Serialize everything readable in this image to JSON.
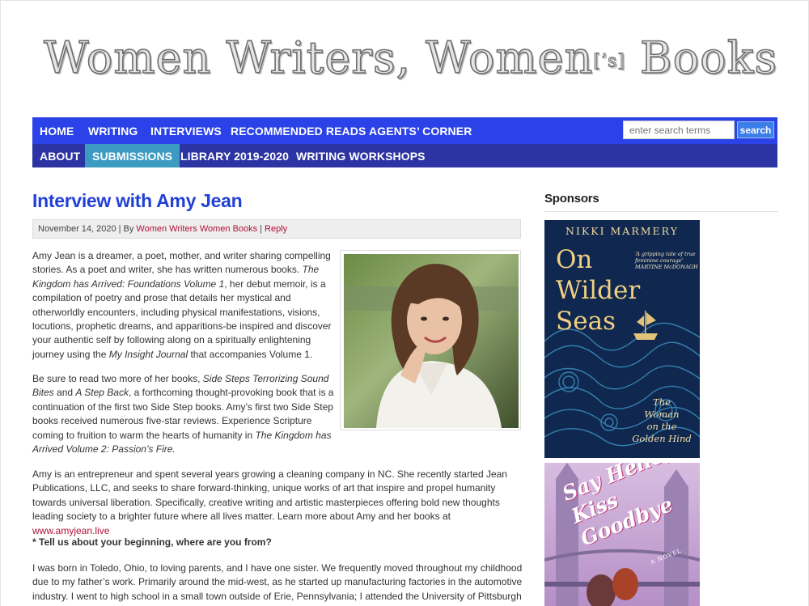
{
  "site": {
    "logo_text_a": "Women Writers, Women",
    "logo_bracket": "[’s]",
    "logo_text_b": " Books"
  },
  "nav": {
    "row1": [
      "HOME",
      "WRITING",
      "INTERVIEWS",
      "RECOMMENDED READS",
      "AGENTS’ CORNER"
    ],
    "row2": [
      "ABOUT",
      "SUBMISSIONS",
      "LIBRARY 2019-2020",
      "WRITING WORKSHOPS"
    ],
    "active": "SUBMISSIONS",
    "search_placeholder": "enter search terms",
    "search_button": "search",
    "colors": {
      "row1": "#2a42e8",
      "row2": "#2c34a4",
      "active": "#3d9bc2"
    }
  },
  "post": {
    "title": "Interview with Amy Jean",
    "meta": {
      "date": "November 14, 2020",
      "by": "By",
      "author_link": "Women Writers Women Books",
      "reply": "Reply"
    },
    "photo_alt_icon": "author-portrait-image",
    "p1": [
      {
        "t": "Amy Jean is a dreamer, a poet, mother, and writer sharing compelling stories. As a poet and writer, she has written numerous books. "
      },
      {
        "t": "The Kingdom has Arrived: Foundations Volume 1",
        "i": true
      },
      {
        "t": ", her debut memoir, is a compilation of poetry and prose that details her mystical and otherworldly encounters, including physical manifestations, visions, locutions, prophetic dreams, and apparitions-be inspired and discover your authentic self by following along on a spiritually enlightening journey using the "
      },
      {
        "t": "My Insight Journal",
        "i": true
      },
      {
        "t": " that accompanies Volume 1."
      }
    ],
    "p2": [
      {
        "t": "Be sure to read two more of her books, "
      },
      {
        "t": "Side Steps Terrorizing Sound Bites",
        "i": true
      },
      {
        "t": " and "
      },
      {
        "t": "A Step Back",
        "i": true
      },
      {
        "t": ", a forthcoming thought-provoking book that is a continuation of the first two Side Step books. Amy’s first two Side Step books received numerous five-star reviews. Experience Scripture coming to fruition to warm the hearts of humanity in "
      },
      {
        "t": "The Kingdom has Arrived Volume 2: Passion’s Fire.",
        "i": true
      }
    ],
    "p3": [
      {
        "t": "Amy is an entrepreneur and spent several years growing a cleaning company in NC. She recently started Jean Publications, LLC, and seeks to share forward-thinking, unique works of art that inspire and propel humanity towards universal liberation. Specifically, creative writing and artistic masterpieces offering bold new thoughts leading society to a brighter future where all lives matter. Learn more about Amy and her books at "
      },
      {
        "t": "www.amyjean.live",
        "link": true
      }
    ],
    "q1": "* Tell us about your beginning, where are you from?",
    "p4": [
      {
        "t": "I was born in Toledo, Ohio, to loving parents, and I have one sister. We frequently moved throughout my childhood due to my father’s work. Primarily around the mid-west, as he started up manufacturing factories in the automotive industry. I went to high school in a small town outside of Erie, Pennsylvania; I attended the University of Pittsburgh and"
      }
    ]
  },
  "sidebar": {
    "title": "Sponsors",
    "book1": {
      "author": "NIKKI MARMERY",
      "quote": "‘A gripping tale of true feminine courage’ MARTINE McDONAGH",
      "title_lines": [
        "On",
        "Wilder",
        "Seas"
      ],
      "subtitle_lines": [
        "The",
        "Woman",
        "on the",
        "Golden Hind"
      ]
    },
    "book2": {
      "title_lines": [
        "Say Hello,",
        "Kiss Goodbye"
      ],
      "note": "A NOVEL"
    }
  }
}
